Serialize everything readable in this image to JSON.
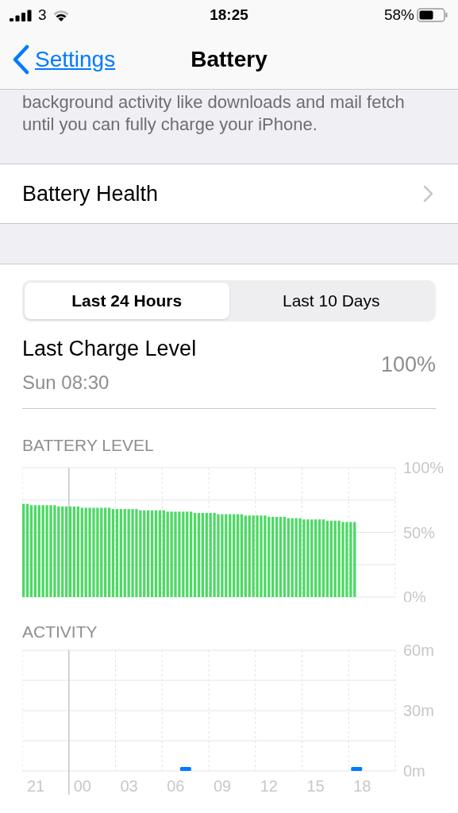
{
  "status_bar": {
    "carrier": "3",
    "time": "18:25",
    "battery_percent": "58%"
  },
  "nav": {
    "back": "Settings",
    "title": "Battery"
  },
  "intro_text": "background activity like downloads and mail fetch until you can fully charge your iPhone.",
  "battery_health": {
    "label": "Battery Health"
  },
  "segments": [
    {
      "label": "Last 24 Hours",
      "selected": true
    },
    {
      "label": "Last 10 Days",
      "selected": false
    }
  ],
  "last_charge": {
    "label": "Last Charge Level",
    "time": "Sun 08:30",
    "value": "100%"
  },
  "battery_level": {
    "title": "BATTERY LEVEL",
    "chart_data": {
      "type": "bar",
      "grid": true,
      "ylim": [
        0,
        100
      ],
      "yticks": [
        {
          "value": 0,
          "label": "0%"
        },
        {
          "value": 50,
          "label": "50%"
        },
        {
          "value": 100,
          "label": "100%"
        }
      ],
      "series": [
        {
          "color": "#4cd964",
          "values": [
            72,
            72,
            71,
            71,
            71,
            71,
            71,
            71,
            71,
            70,
            70,
            70,
            70,
            70,
            70,
            69,
            69,
            69,
            69,
            69,
            69,
            69,
            69,
            68,
            68,
            68,
            68,
            68,
            68,
            68,
            67,
            67,
            67,
            67,
            67,
            67,
            67,
            66,
            66,
            66,
            66,
            66,
            66,
            66,
            65,
            65,
            65,
            65,
            65,
            65,
            64,
            64,
            64,
            64,
            64,
            64,
            64,
            63,
            63,
            63,
            63,
            63,
            63,
            62,
            62,
            62,
            62,
            62,
            61,
            61,
            61,
            61,
            60,
            60,
            60,
            60,
            60,
            60,
            59,
            59,
            59,
            59,
            58,
            58,
            58,
            58
          ]
        }
      ]
    }
  },
  "activity": {
    "title": "ACTIVITY",
    "chart_data": {
      "type": "bar",
      "grid": true,
      "ylim": [
        0,
        60
      ],
      "yticks": [
        {
          "value": 0,
          "label": "0m"
        },
        {
          "value": 30,
          "label": "30m"
        },
        {
          "value": 60,
          "label": "60m"
        }
      ],
      "categories": [
        "21",
        null,
        null,
        "00",
        null,
        null,
        "03",
        null,
        null,
        "06",
        null,
        null,
        "09",
        null,
        null,
        "12",
        null,
        null,
        "15",
        null,
        null,
        "18",
        null,
        null
      ],
      "series": [
        {
          "color": "#007aff",
          "values": [
            0,
            0,
            0,
            0,
            0,
            0,
            0,
            0,
            0,
            0,
            2,
            0,
            0,
            0,
            0,
            0,
            0,
            0,
            0,
            0,
            0,
            2,
            null,
            null
          ]
        }
      ]
    }
  }
}
